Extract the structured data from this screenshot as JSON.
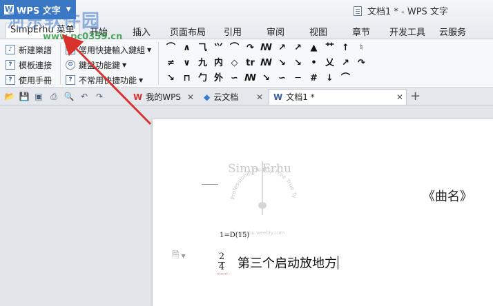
{
  "app": {
    "menu_button": "WPS 文字",
    "window_title": "文档1 * - WPS 文字",
    "watermark_logo": "河东软件园",
    "watermark_url": "www.pc0359.cn"
  },
  "menus": [
    {
      "label": "SimpErhu 菜单",
      "active": true
    },
    {
      "label": "开始"
    },
    {
      "label": "插入"
    },
    {
      "label": "页面布局"
    },
    {
      "label": "引用"
    },
    {
      "label": "审阅"
    },
    {
      "label": "视图"
    },
    {
      "label": "章节"
    },
    {
      "label": "开发工具"
    },
    {
      "label": "云服务"
    }
  ],
  "ribbon": {
    "new_score": "新建樂譜",
    "template_link": "模板連接",
    "user_manual": "使用手冊",
    "common_shortcut": "常用快捷輸入鍵組",
    "key_function": "鍵盤功能鍵",
    "uncommon_shortcut": "不常用快捷功能",
    "symbols": [
      "⌒",
      "∧",
      "⺄",
      "⺍",
      "⌒",
      "↷",
      "ꟿ",
      "↗",
      "↗",
      "▲",
      "⺿",
      "↑",
      "♮",
      "≠",
      "∨",
      "九",
      "内",
      "◇",
      "tr",
      "ꟿ",
      "↘",
      "↘",
      "•",
      "乂",
      "↗",
      "↷",
      "↘",
      "⊓",
      "勹",
      "外",
      "∽",
      "ꟿ",
      "↘",
      "∽",
      "─",
      "#",
      "↓",
      "⌒"
    ]
  },
  "tabs": [
    {
      "label": "我的WPS",
      "icon": "W"
    },
    {
      "label": "云文档",
      "icon": "◆"
    },
    {
      "label": "文档1 *",
      "icon": "W",
      "active": true
    }
  ],
  "document": {
    "stamp_title": "Simp Erhu",
    "stamp_ring": "Professional Quality Free True Type Font",
    "stamp_url": "simperhu.weebly.com",
    "qupu": "《曲名》",
    "key": "1=D(15)",
    "time_sig_top": "2",
    "time_sig_bottom": "4",
    "line_text": "第三个启动放地方"
  }
}
